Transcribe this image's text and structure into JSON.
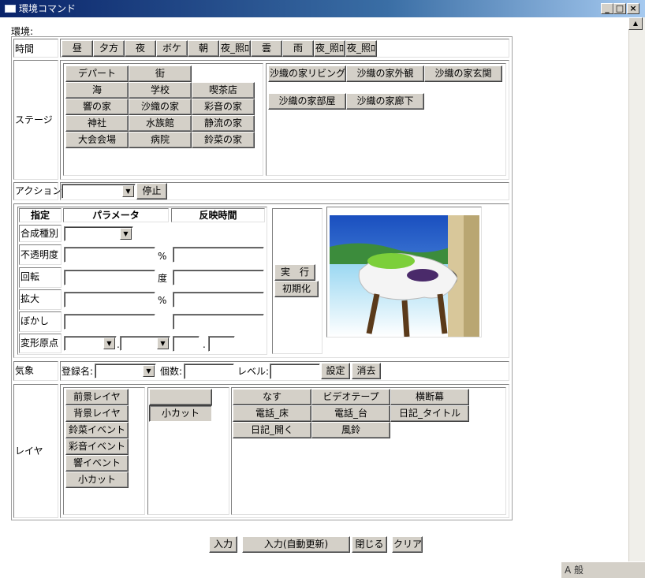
{
  "window": {
    "title": "環境コマンド",
    "min": "_",
    "max": "□",
    "close": "×"
  },
  "section_label": "環境:",
  "time": {
    "label": "時間",
    "buttons": [
      "昼",
      "夕方",
      "夜",
      "ボケ",
      "朝",
      "夜_照ﾛ",
      "雲",
      "雨",
      "夜_照ﾛ",
      "夜_照ﾛ"
    ]
  },
  "stage": {
    "label": "ステージ",
    "left_buttons": [
      "デパート",
      "街",
      "海",
      "学校",
      "喫茶店",
      "響の家",
      "沙織の家",
      "彩音の家",
      "神社",
      "水族館",
      "静流の家",
      "大会会場",
      "病院",
      "鈴菜の家"
    ],
    "right_buttons": [
      "沙織の家リビング",
      "沙織の家外観",
      "沙織の家玄関",
      "沙織の家部屋",
      "沙織の家廊下"
    ]
  },
  "action": {
    "label": "アクション",
    "stop": "停止"
  },
  "params": {
    "headers": [
      "指定",
      "パラメータ",
      "反映時間"
    ],
    "rows": [
      "合成種別",
      "不透明度",
      "回転",
      "拡大",
      "ぼかし",
      "変形原点"
    ],
    "units": [
      "%",
      "度",
      "%"
    ],
    "dot": ".",
    "dot2": ".",
    "run": "実　行",
    "reset": "初期化"
  },
  "weather": {
    "label": "気象",
    "reg_name": "登録名:",
    "count": "個数:",
    "level": "レベル:",
    "set": "設定",
    "erase": "消去"
  },
  "layer": {
    "label": "レイヤ",
    "left": [
      "前景レイヤ",
      "背景レイヤ",
      "鈴菜イベント",
      "彩音イベント",
      "響イベント",
      "小カット"
    ],
    "mid": [
      "",
      "小カット"
    ],
    "right": [
      "なす",
      "ビデオテープ",
      "横断幕",
      "電話_床",
      "電話_台",
      "日記_タイトル",
      "日記_開く",
      "風鈴"
    ]
  },
  "footer": {
    "input": "入力",
    "input_auto": "入力(自動更新)",
    "close": "閉じる",
    "clear": "クリア"
  },
  "tray": "A 般",
  "colors": {
    "titlebar": "#0a246a",
    "face": "#d4d0c8"
  }
}
